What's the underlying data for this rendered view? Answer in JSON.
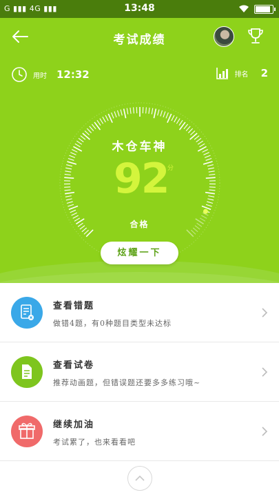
{
  "status_bar": {
    "carrier_left": "G",
    "network": "4G",
    "time": "13:48",
    "battery_level": 0.95
  },
  "header": {
    "title": "考试成绩"
  },
  "stats": {
    "time_label": "用时",
    "time_value": "12:32",
    "rank_label": "排名",
    "rank_value": "2"
  },
  "result": {
    "name": "木仓车神",
    "score": "92",
    "unit": "分",
    "grade": "合格",
    "score_fraction": 0.92
  },
  "show_off_button": "炫耀一下",
  "items": [
    {
      "title": "查看错题",
      "subtitle": "做错4题，有0种题目类型未达标",
      "icon": "error-review-icon",
      "color": "#3aa8e8"
    },
    {
      "title": "查看试卷",
      "subtitle": "推荐动画题，但错误题还要多多练习哦~",
      "icon": "paper-icon",
      "color": "#7ec51e"
    },
    {
      "title": "继续加油",
      "subtitle": "考试累了，也来看看吧",
      "icon": "gift-icon",
      "color": "#f06a6a"
    }
  ],
  "colors": {
    "primary": "#8ed21b",
    "score": "#d4f53c",
    "status_bar": "#4a7d0c"
  }
}
